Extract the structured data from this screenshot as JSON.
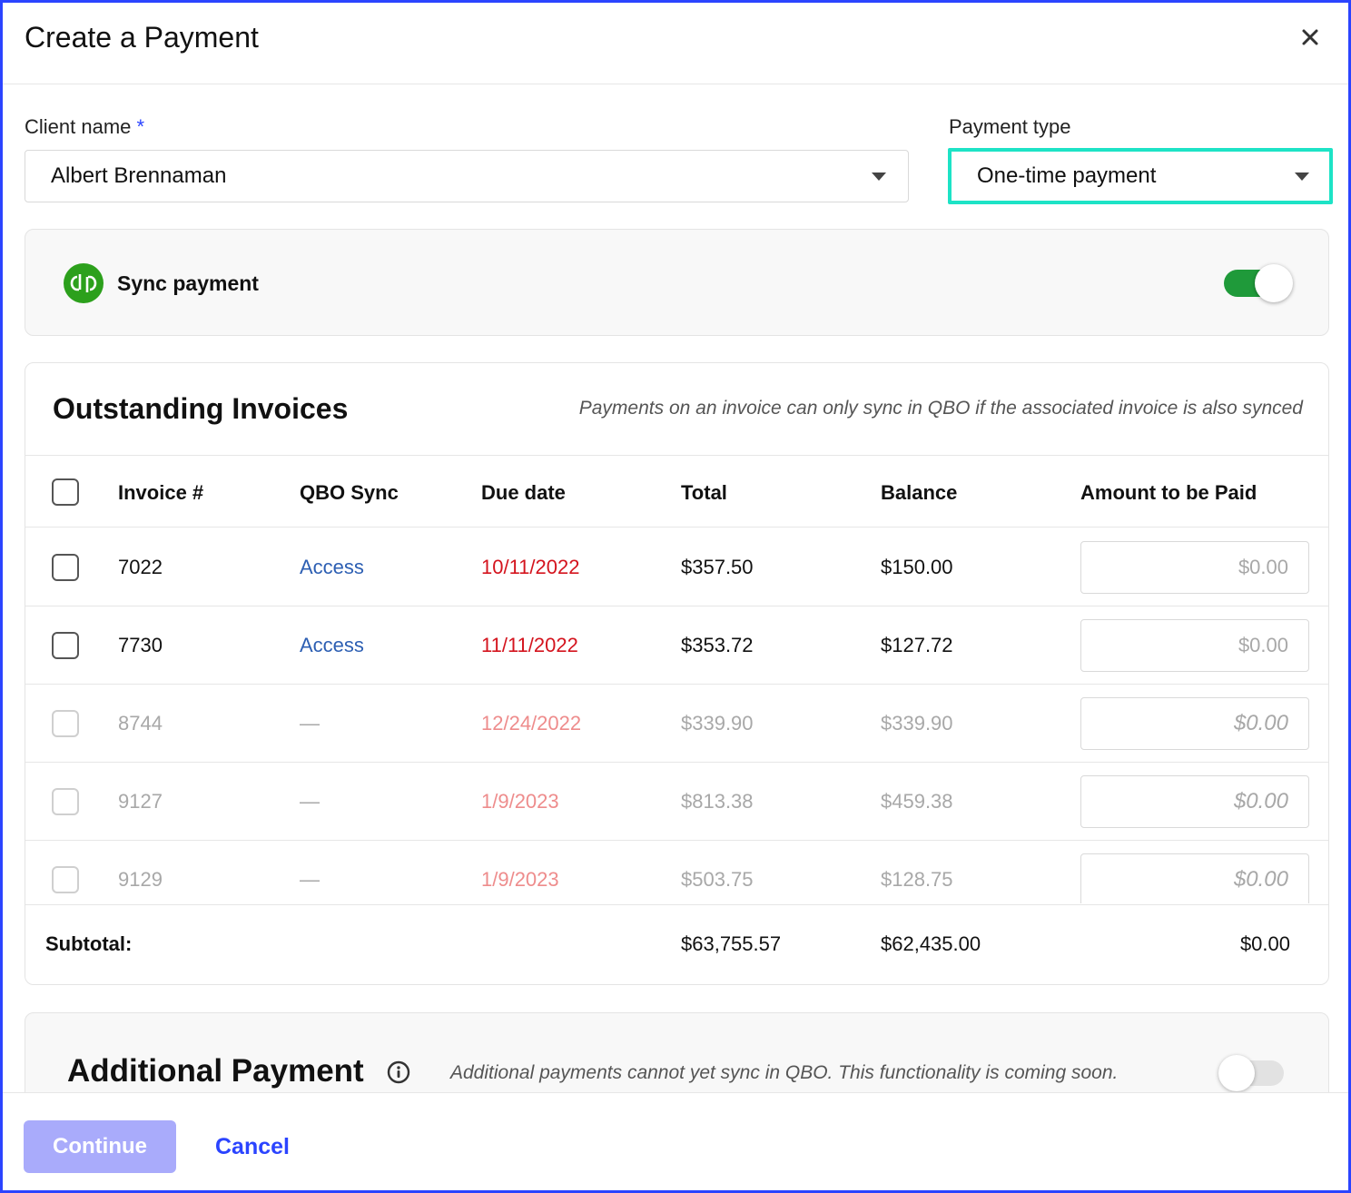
{
  "modal": {
    "title": "Create a Payment"
  },
  "form": {
    "client_label": "Client name",
    "client_required": "*",
    "client_value": "Albert Brennaman",
    "payment_type_label": "Payment type",
    "payment_type_value": "One-time payment"
  },
  "sync": {
    "label": "Sync payment",
    "enabled": true
  },
  "invoices": {
    "title": "Outstanding Invoices",
    "note": "Payments on an invoice can only sync in QBO if the associated invoice is also synced",
    "headers": {
      "invoice": "Invoice #",
      "qbo_sync": "QBO Sync",
      "due_date": "Due date",
      "total": "Total",
      "balance": "Balance",
      "amount": "Amount to be Paid"
    },
    "rows": [
      {
        "invoice": "7022",
        "qbo_sync": "Access",
        "due": "10/11/2022",
        "total": "$357.50",
        "balance": "$150.00",
        "amount_placeholder": "$0.00"
      },
      {
        "invoice": "7730",
        "qbo_sync": "Access",
        "due": "11/11/2022",
        "total": "$353.72",
        "balance": "$127.72",
        "amount_placeholder": "$0.00"
      },
      {
        "invoice": "8744",
        "qbo_sync": "—",
        "due": "12/24/2022",
        "total": "$339.90",
        "balance": "$339.90",
        "amount_placeholder": "$0.00"
      },
      {
        "invoice": "9127",
        "qbo_sync": "—",
        "due": "1/9/2023",
        "total": "$813.38",
        "balance": "$459.38",
        "amount_placeholder": "$0.00"
      },
      {
        "invoice": "9129",
        "qbo_sync": "—",
        "due": "1/9/2023",
        "total": "$503.75",
        "balance": "$128.75",
        "amount_placeholder": "$0.00"
      }
    ],
    "subtotal": {
      "label": "Subtotal:",
      "total": "$63,755.57",
      "balance": "$62,435.00",
      "amount": "$0.00"
    }
  },
  "additional": {
    "title": "Additional Payment",
    "note": "Additional payments cannot yet sync in QBO. This functionality is coming soon.",
    "enabled": false
  },
  "footer": {
    "continue_label": "Continue",
    "cancel_label": "Cancel"
  },
  "colors": {
    "accent": "#2b44ff",
    "focus_ring": "#1de3c6",
    "toggle_on": "#1f9a3a",
    "overdue": "#d4141e",
    "link": "#2d5fb3",
    "qb_green": "#2ca01c"
  },
  "icons": [
    "close-icon",
    "chevron-down-icon",
    "quickbooks-logo-icon",
    "info-icon"
  ]
}
